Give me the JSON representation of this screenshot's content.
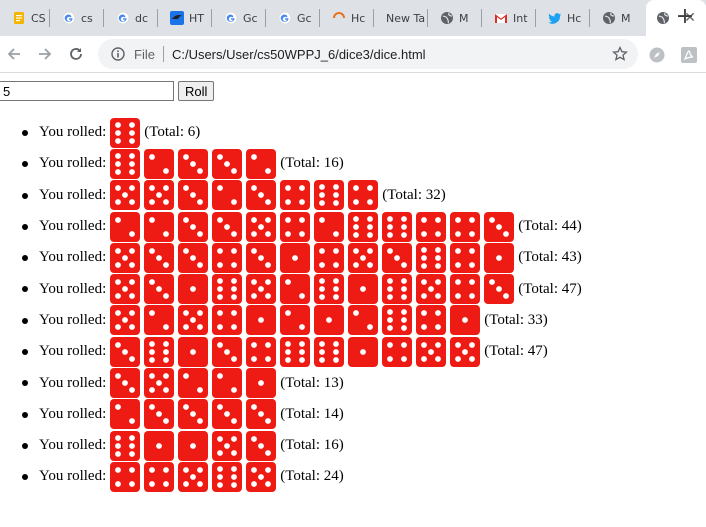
{
  "browser": {
    "tabs": [
      {
        "title": "CS",
        "icon": "doc-icon",
        "active": false
      },
      {
        "title": "cs",
        "icon": "google-icon",
        "active": false
      },
      {
        "title": "dc",
        "icon": "google-icon",
        "active": false
      },
      {
        "title": "HT",
        "icon": "html-bird-icon",
        "active": false
      },
      {
        "title": "Gc",
        "icon": "google-icon",
        "active": false
      },
      {
        "title": "Gc",
        "icon": "google-icon",
        "active": false
      },
      {
        "title": "Hc",
        "icon": "spinner-icon",
        "active": false
      },
      {
        "title": "New Ta",
        "icon": "",
        "active": false
      },
      {
        "title": "M",
        "icon": "globe-icon",
        "active": false
      },
      {
        "title": "Int",
        "icon": "gmail-icon",
        "active": false
      },
      {
        "title": "Hc",
        "icon": "twitter-icon",
        "active": false
      },
      {
        "title": "M",
        "icon": "globe-icon",
        "active": false
      },
      {
        "title": "",
        "icon": "globe-icon",
        "active": true
      }
    ],
    "scheme_label": "File",
    "url": "C:/Users/User/cs50WPPJ_6/dice3/dice.html"
  },
  "form": {
    "quantity_value": "5",
    "roll_label": "Roll"
  },
  "rolls": [
    {
      "label": "You rolled:",
      "dice": [
        6
      ],
      "total_text": "(Total: 6)"
    },
    {
      "label": "You rolled:",
      "dice": [
        6,
        2,
        3,
        3,
        2
      ],
      "total_text": "(Total: 16)"
    },
    {
      "label": "You rolled:",
      "dice": [
        5,
        5,
        3,
        2,
        3,
        4,
        6,
        4
      ],
      "total_text": "(Total: 32)"
    },
    {
      "label": "You rolled:",
      "dice": [
        2,
        2,
        3,
        3,
        5,
        4,
        2,
        6,
        6,
        4,
        4,
        3
      ],
      "total_text": "(Total: 44)"
    },
    {
      "label": "You rolled:",
      "dice": [
        5,
        3,
        3,
        4,
        3,
        1,
        4,
        5,
        3,
        6,
        4,
        1
      ],
      "total_text": "(Total: 43)"
    },
    {
      "label": "You rolled:",
      "dice": [
        5,
        3,
        1,
        6,
        5,
        2,
        6,
        1,
        6,
        5,
        4,
        3
      ],
      "total_text": "(Total: 47)"
    },
    {
      "label": "You rolled:",
      "dice": [
        5,
        2,
        5,
        4,
        1,
        2,
        1,
        2,
        6,
        4,
        1
      ],
      "total_text": "(Total: 33)"
    },
    {
      "label": "You rolled:",
      "dice": [
        3,
        6,
        1,
        3,
        4,
        6,
        6,
        1,
        4,
        5,
        5
      ],
      "total_text": "(Total: 47)"
    },
    {
      "label": "You rolled:",
      "dice": [
        3,
        5,
        2,
        2,
        1
      ],
      "total_text": "(Total: 13)"
    },
    {
      "label": "You rolled:",
      "dice": [
        2,
        3,
        3,
        3,
        3
      ],
      "total_text": "(Total: 14)"
    },
    {
      "label": "You rolled:",
      "dice": [
        6,
        1,
        1,
        5,
        3
      ],
      "total_text": "(Total: 16)"
    },
    {
      "label": "You rolled:",
      "dice": [
        4,
        4,
        5,
        6,
        5
      ],
      "total_text": "(Total: 24)"
    }
  ],
  "colors": {
    "die_face": "#ee1b14",
    "die_pip": "#ffffff",
    "tabstrip": "#dee1e6"
  }
}
